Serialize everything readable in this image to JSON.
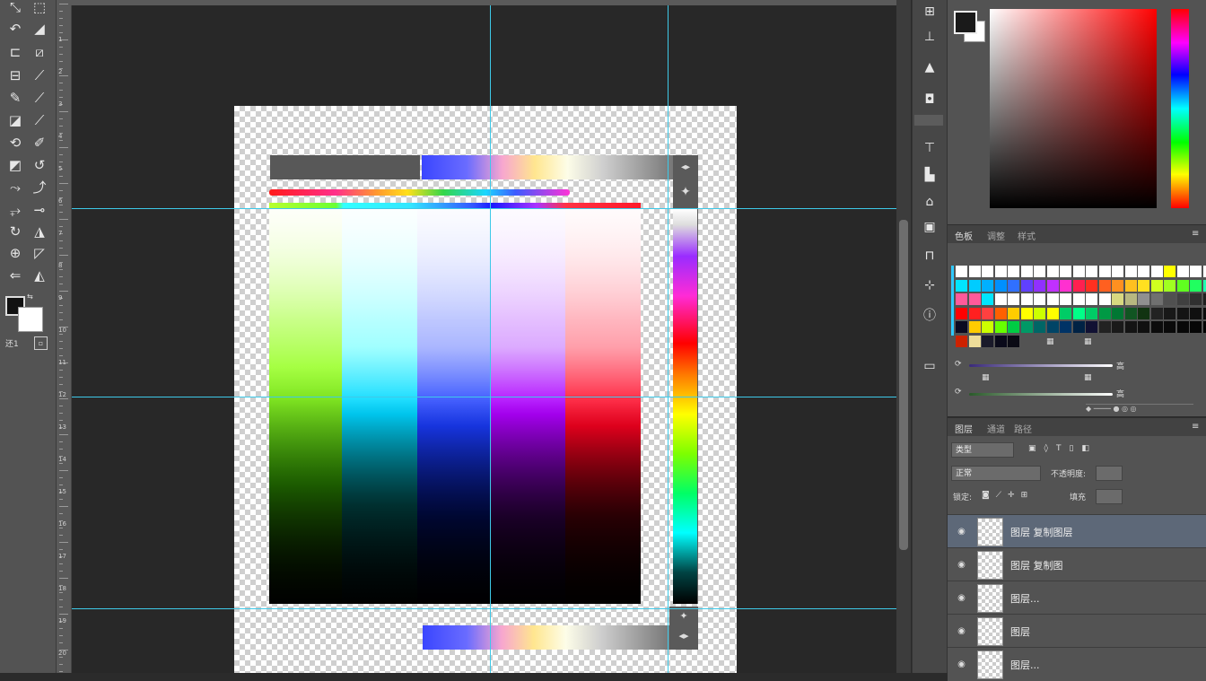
{
  "colors": {
    "accent_guides": "#3ec9e8",
    "panel_bg": "#535353",
    "canvas_bg": "#282828",
    "selected_layer": "#5d6878"
  },
  "toolbar": {
    "tools": [
      "move-tool-icon",
      "marquee-tool-icon",
      "lasso-tool-icon",
      "crop-tool-icon",
      "eyedropper-tool-icon",
      "healing-brush-icon",
      "brush-tool-icon",
      "clone-stamp-icon",
      "history-brush-icon",
      "eraser-tool-icon",
      "gradient-tool-icon",
      "blur-tool-icon",
      "dodge-tool-icon",
      "pen-tool-icon",
      "type-tool-icon",
      "path-select-icon",
      "shape-tool-icon",
      "hand-tool-icon",
      "zoom-tool-icon",
      "edit-toolbar-icon"
    ],
    "mode_label": "还1"
  },
  "ruler": {
    "labels": [
      "1",
      "2",
      "3",
      "4",
      "5",
      "6",
      "7",
      "8",
      "9",
      "10",
      "11",
      "12",
      "13",
      "14",
      "15",
      "16",
      "17",
      "18",
      "19",
      "20"
    ]
  },
  "midbar": {
    "icons": [
      "history-icon",
      "properties-icon",
      "actions-icon",
      "adjustments-icon",
      "brush-presets-icon",
      "character-icon",
      "paragraph-icon",
      "styles-icon",
      "channels-icon",
      "paths-icon",
      "info-icon",
      "navigator-icon"
    ]
  },
  "swatches_panel": {
    "tabs": [
      "色板",
      "调整",
      "样式"
    ],
    "slider1_label": "高",
    "slider2_label": "高"
  },
  "layers_panel": {
    "tabs": [
      "图层",
      "通道",
      "路径"
    ],
    "kind_filter": "类型",
    "blend_mode": "正常",
    "opacity_label": "不透明度:",
    "lock_label": "锁定:",
    "fill_label": "填充",
    "layers": [
      {
        "name": "图层 复制图层",
        "selected": true
      },
      {
        "name": "图层 复制图",
        "selected": false
      },
      {
        "name": "图层...",
        "selected": false
      },
      {
        "name": "图层",
        "selected": false
      },
      {
        "name": "图层...",
        "selected": false
      }
    ]
  }
}
